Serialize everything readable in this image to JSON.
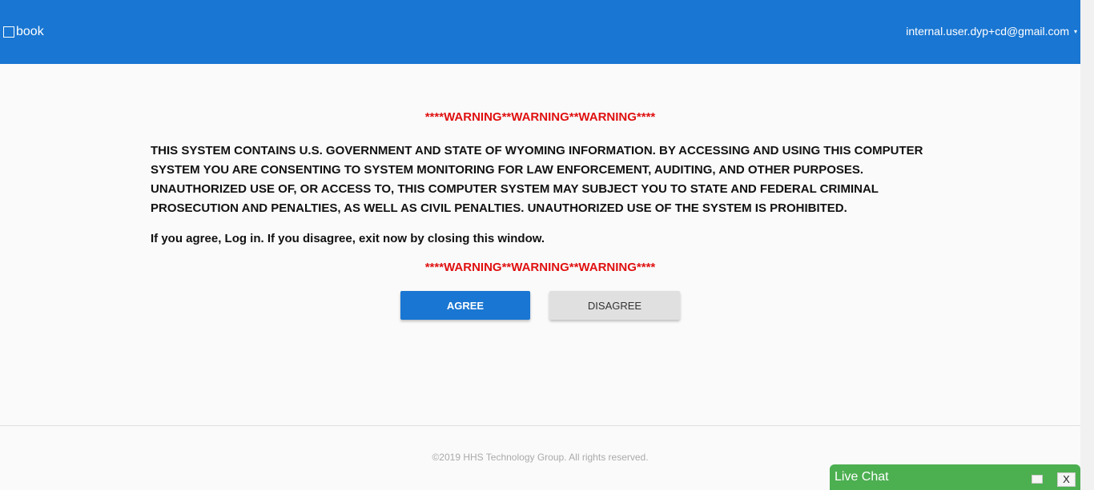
{
  "header": {
    "logo_text": "book",
    "user_email": "internal.user.dyp+cd@gmail.com",
    "caret": "▾",
    "background_color": "#1976d2"
  },
  "content": {
    "warning_top": "****WARNING**WARNING**WARNING****",
    "notice": "THIS SYSTEM CONTAINS U.S. GOVERNMENT AND STATE OF WYOMING INFORMATION. BY ACCESSING AND USING THIS COMPUTER SYSTEM YOU ARE CONSENTING TO SYSTEM MONITORING FOR LAW ENFORCEMENT, AUDITING, AND OTHER PURPOSES. UNAUTHORIZED USE OF, OR ACCESS TO, THIS COMPUTER SYSTEM MAY SUBJECT YOU TO STATE AND FEDERAL CRIMINAL PROSECUTION AND PENALTIES, AS WELL AS CIVIL PENALTIES. UNAUTHORIZED USE OF THE SYSTEM IS PROHIBITED.",
    "agree_instruction": "If you agree, Log in. If you disagree, exit now by closing this window.",
    "warning_bottom": "****WARNING**WARNING**WARNING****",
    "warning_color": "#e01010"
  },
  "buttons": {
    "agree_label": "AGREE",
    "disagree_label": "DISAGREE",
    "agree_color": "#1976d2",
    "disagree_color": "#e0e0e0"
  },
  "footer": {
    "copyright": "©2019 HHS Technology Group. All rights reserved."
  },
  "live_chat": {
    "label": "Live Chat",
    "close_label": "X",
    "color": "#4caf50"
  }
}
